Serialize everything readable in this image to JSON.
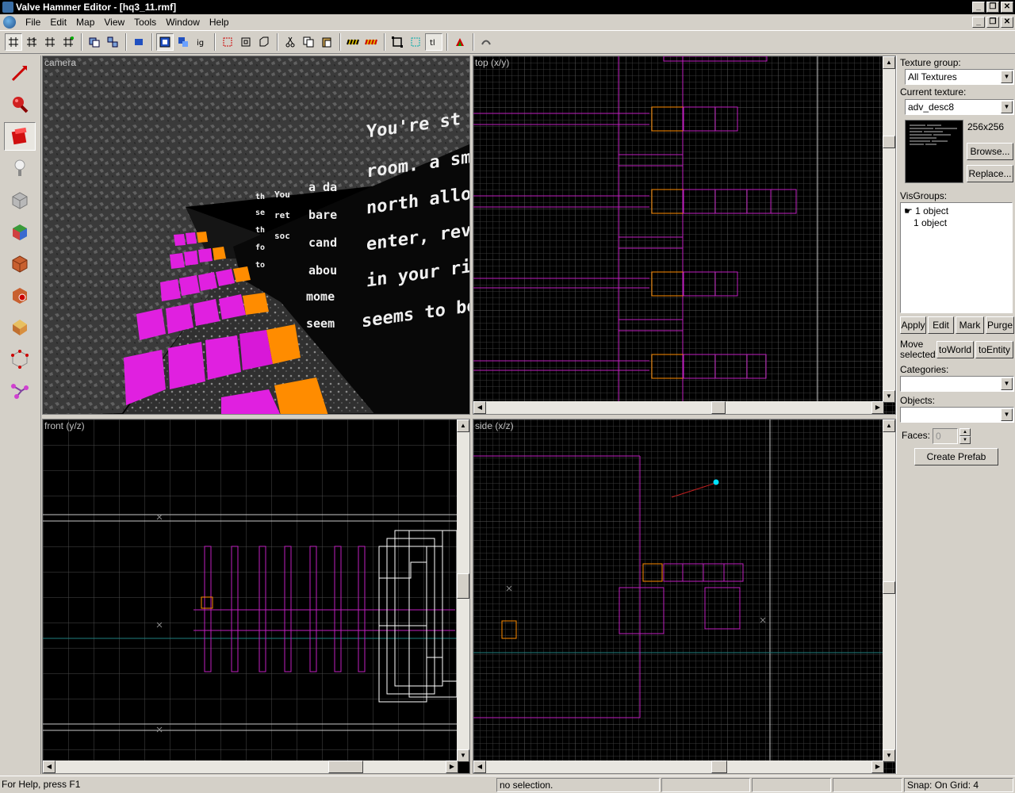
{
  "window": {
    "title": "Valve Hammer Editor - [hq3_11.rmf]",
    "min_glyph": "_",
    "max_glyph": "❐",
    "close_glyph": "✕"
  },
  "menu": {
    "items": [
      "File",
      "Edit",
      "Map",
      "View",
      "Tools",
      "Window",
      "Help"
    ]
  },
  "viewports": {
    "camera": "camera",
    "top": "top (x/y)",
    "front": "front (y/z)",
    "side": "side (x/z)"
  },
  "camera_text": {
    "line1": "You're st",
    "line2": "room. a sm",
    "line3": "north allo",
    "line4": "enter, rev",
    "line5": "in your ri",
    "line6": "seems to be",
    "col_a": [
      "a da",
      "bare",
      "cand",
      "abou",
      "mome",
      "seem"
    ],
    "col_b": [
      "You",
      "ret",
      "soc"
    ],
    "col_c": [
      "th",
      "se",
      "th",
      "fo",
      "to"
    ]
  },
  "right_panel": {
    "texture_group_label": "Texture group:",
    "texture_group_value": "All Textures",
    "current_texture_label": "Current texture:",
    "current_texture_value": "adv_desc8",
    "texture_size": "256x256",
    "browse": "Browse...",
    "replace": "Replace...",
    "visgroups_label": "VisGroups:",
    "visgroups": [
      "1 object",
      "1 object"
    ],
    "apply": "Apply",
    "edit": "Edit",
    "mark": "Mark",
    "purge": "Purge",
    "move_selected_label": "Move selected:",
    "to_world": "toWorld",
    "to_entity": "toEntity",
    "categories_label": "Categories:",
    "objects_label": "Objects:",
    "faces_label": "Faces:",
    "faces_value": "0",
    "create_prefab": "Create Prefab"
  },
  "status": {
    "help": "For Help, press F1",
    "selection": "no selection.",
    "snap": "Snap: On Grid: 4"
  },
  "colors": {
    "brush_magenta": "#c020c0",
    "brush_orange": "#ff8c00",
    "grid_minor": "#303030",
    "grid_major": "#6a6a6a",
    "entity_cyan": "#00e0ff"
  }
}
